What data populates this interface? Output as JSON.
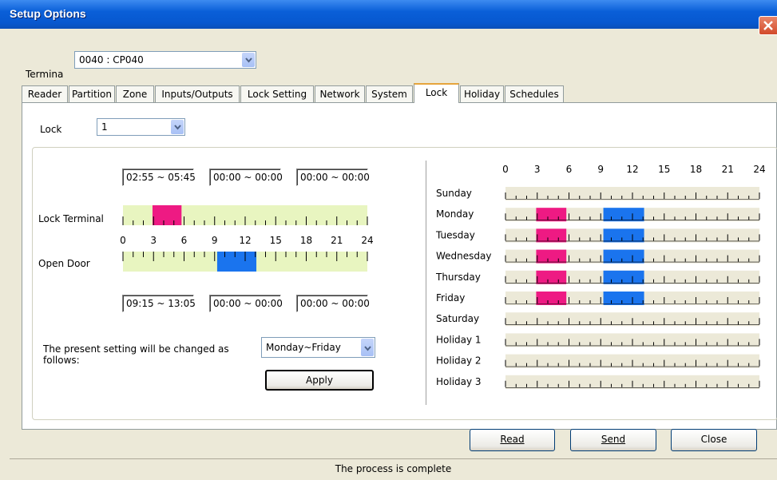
{
  "window": {
    "title": "Setup Options"
  },
  "terminal": {
    "label": "Termina",
    "value": "0040 : CP040"
  },
  "tabs": [
    {
      "label": "Reader"
    },
    {
      "label": "Partition"
    },
    {
      "label": "Zone"
    },
    {
      "label": "Inputs/Outputs"
    },
    {
      "label": "Lock Setting"
    },
    {
      "label": "Network"
    },
    {
      "label": "System"
    },
    {
      "label": "Lock"
    },
    {
      "label": "Holiday"
    },
    {
      "label": "Schedules"
    }
  ],
  "active_tab": "Lock",
  "lock": {
    "label": "Lock",
    "value": "1"
  },
  "lock_terminal": {
    "label": "Lock Terminal",
    "ranges": [
      "02:55 ~ 05:45",
      "00:00 ~ 00:00",
      "00:00 ~ 00:00"
    ],
    "active_hours": [
      [
        2.9,
        5.75
      ]
    ],
    "color": "#ee1a83"
  },
  "open_door": {
    "label": "Open Door",
    "ranges": [
      "09:15 ~ 13:05",
      "00:00 ~ 00:00",
      "00:00 ~ 00:00"
    ],
    "active_hours": [
      [
        9.25,
        13.1
      ]
    ],
    "color": "#1a74ee"
  },
  "hour_labels": [
    "0",
    "3",
    "6",
    "9",
    "12",
    "15",
    "18",
    "21",
    "24"
  ],
  "change_note": "The present setting will be changed as follows:",
  "apply_scope": "Monday~Friday",
  "apply_label": "Apply",
  "weekly": {
    "days": [
      {
        "name": "Sunday",
        "lock": [],
        "open": []
      },
      {
        "name": "Monday",
        "lock": [
          [
            2.9,
            5.75
          ]
        ],
        "open": [
          [
            9.25,
            13.1
          ]
        ]
      },
      {
        "name": "Tuesday",
        "lock": [
          [
            2.9,
            5.75
          ]
        ],
        "open": [
          [
            9.25,
            13.1
          ]
        ]
      },
      {
        "name": "Wednesday",
        "lock": [
          [
            2.9,
            5.75
          ]
        ],
        "open": [
          [
            9.25,
            13.1
          ]
        ]
      },
      {
        "name": "Thursday",
        "lock": [
          [
            2.9,
            5.75
          ]
        ],
        "open": [
          [
            9.25,
            13.1
          ]
        ]
      },
      {
        "name": "Friday",
        "lock": [
          [
            2.9,
            5.75
          ]
        ],
        "open": [
          [
            9.25,
            13.1
          ]
        ]
      },
      {
        "name": "Saturday",
        "lock": [],
        "open": []
      },
      {
        "name": "Holiday 1",
        "lock": [],
        "open": []
      },
      {
        "name": "Holiday 2",
        "lock": [],
        "open": []
      },
      {
        "name": "Holiday 3",
        "lock": [],
        "open": []
      }
    ]
  },
  "buttons": {
    "read": "Read",
    "send": "Send",
    "close": "Close"
  },
  "status": "The process is complete",
  "colors": {
    "timeline_bg": "#e8f5c0",
    "week_row_bg": "#ece9d8",
    "lock": "#ee1a83",
    "open": "#1a74ee"
  }
}
